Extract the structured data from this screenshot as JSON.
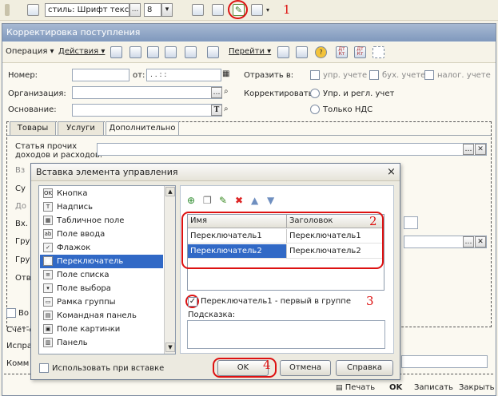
{
  "toolbar": {
    "style_label": "стиль: Шрифт текста",
    "ellipsis": "...",
    "font_size": "8",
    "callout_1": "1"
  },
  "window": {
    "title": "Корректировка поступления",
    "menu": {
      "operation": "Операция",
      "actions": "Действия",
      "goto": "Перейти",
      "help_glyph": "?",
      "dt_kt_1": "Дт Кт",
      "dt_kt_2": "Дт Кт"
    },
    "fields": {
      "number_label": "Номер:",
      "from_label": "от:",
      "date_value": ". .   : :",
      "org_label": "Организация:",
      "base_label": "Основание:",
      "reflect_label": "Отразить в:",
      "reflect_mgmt": "упр. учете",
      "reflect_acc": "бух. учете",
      "reflect_tax": "налог. учете",
      "adjust_label": "Корректировать:",
      "adjust_opt1": "Упр. и регл. учет",
      "adjust_opt2": "Только НДС",
      "t_button": "T"
    },
    "tabs": [
      "Товары",
      "Услуги",
      "Дополнительно"
    ],
    "tab_content": {
      "other_income_label": "Статья прочих\nдоходов и расходов:",
      "frag_vz": "Вз",
      "frag_su": "Су",
      "frag_do": "До",
      "frag_vh": "Вх.",
      "frag_gr1": "Гру",
      "frag_gr2": "Гру",
      "frag_ot": "Отв"
    },
    "lower": {
      "frag_vo": "Во",
      "frag_schet": "Счет-ф",
      "frag_ispr": "Испра",
      "frag_komm": "Комм"
    },
    "bottom": {
      "print": "Печать",
      "ok": "OK",
      "save": "Записать",
      "close": "Закрыть"
    }
  },
  "dialog": {
    "title": "Вставка элемента управления",
    "controls": [
      {
        "label": "Кнопка",
        "icon": "button-icon",
        "glyph": "OK"
      },
      {
        "label": "Надпись",
        "icon": "label-icon",
        "glyph": "T"
      },
      {
        "label": "Табличное поле",
        "icon": "table-field-icon",
        "glyph": "▦"
      },
      {
        "label": "Поле ввода",
        "icon": "input-field-icon",
        "glyph": "ab"
      },
      {
        "label": "Флажок",
        "icon": "checkbox-icon",
        "glyph": "✓"
      },
      {
        "label": "Переключатель",
        "icon": "radio-icon",
        "glyph": "●"
      },
      {
        "label": "Поле списка",
        "icon": "list-field-icon",
        "glyph": "≡"
      },
      {
        "label": "Поле выбора",
        "icon": "combo-field-icon",
        "glyph": "▾"
      },
      {
        "label": "Рамка группы",
        "icon": "group-frame-icon",
        "glyph": "▭"
      },
      {
        "label": "Командная панель",
        "icon": "command-panel-icon",
        "glyph": "▤"
      },
      {
        "label": "Поле картинки",
        "icon": "picture-field-icon",
        "glyph": "▣"
      },
      {
        "label": "Панель",
        "icon": "panel-icon",
        "glyph": "▥"
      }
    ],
    "selected_index": 5,
    "grid": {
      "headers": [
        "Имя",
        "Заголовок"
      ],
      "rows": [
        {
          "name": "Переключатель1",
          "caption": "Переключатель1"
        },
        {
          "name": "Переключатель2",
          "caption": "Переключатель2"
        }
      ],
      "selected_row": 1
    },
    "first_in_group": "Переключатель1 - первый в группе",
    "hint_label": "Подсказка:",
    "use_on_insert": "Использовать при вставке",
    "buttons": {
      "ok": "OK",
      "cancel": "Отмена",
      "help": "Справка"
    },
    "callouts": {
      "c2": "2",
      "c3": "3",
      "c4": "4"
    },
    "close_glyph": "×"
  },
  "colors": {
    "selection": "#3169c6",
    "callout": "#dd1111",
    "title_bar": "#8ea6c8"
  }
}
